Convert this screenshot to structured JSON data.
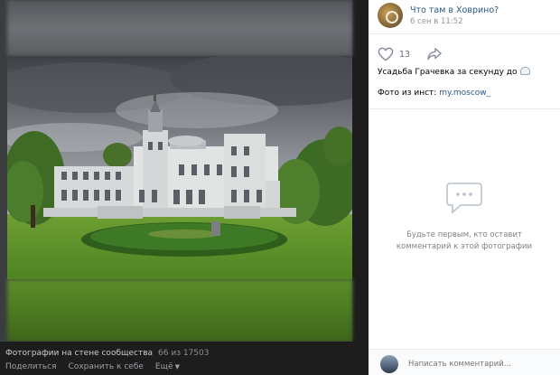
{
  "post": {
    "author": "Что там в Ховрино?",
    "date": "6 сен в 11:52",
    "likes": "13",
    "caption": "Усадьба Грачевка за секунду до",
    "source_prefix": "Фото из инст:",
    "source_link": "my.moscow_"
  },
  "photo_footer": {
    "album": "Фотографии на стене сообщества",
    "counter": "66 из 17503",
    "share": "Поделиться",
    "save": "Сохранить к себе",
    "more": "Ещё"
  },
  "comments": {
    "empty_line1": "Будьте первым, кто оставит",
    "empty_line2": "комментарий к этой фотографии",
    "placeholder": "Написать комментарий..."
  },
  "icons": {
    "like": "heart-icon",
    "share": "share-arrow-icon",
    "empty": "speech-bubble-icon",
    "more": "chevron-down-icon"
  },
  "colors": {
    "link": "#2a5885",
    "viewer_bg": "#1d1d1d"
  }
}
